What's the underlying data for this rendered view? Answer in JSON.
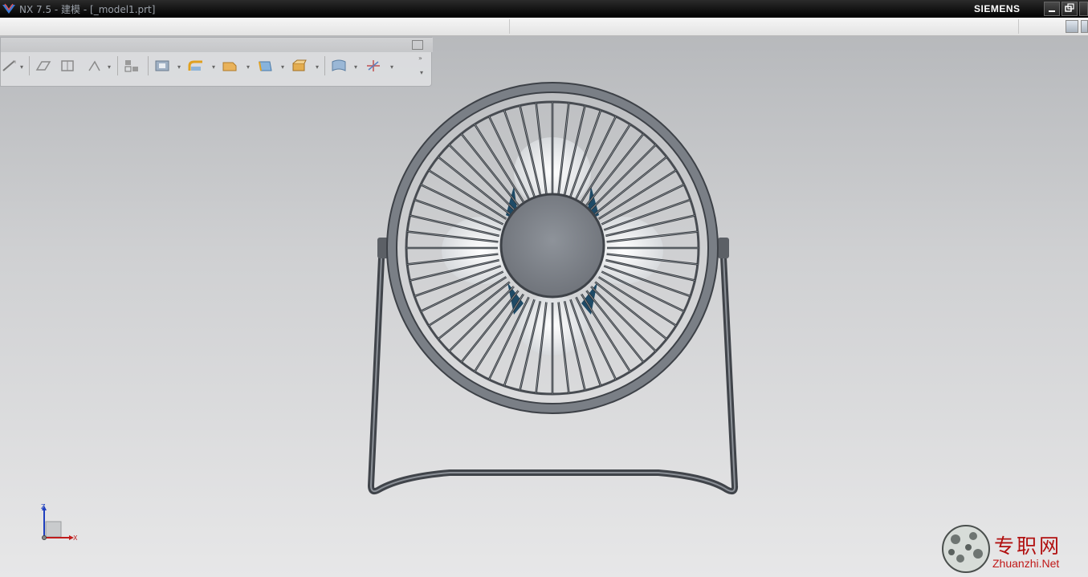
{
  "window": {
    "title": "NX 7.5 - 建模 - [_model1.prt]",
    "brand": "SIEMENS"
  },
  "triad": {
    "z_label": "Z",
    "x_label": "X"
  },
  "watermark": {
    "chinese": "专职网",
    "url": "Zhuanzhi.Net"
  },
  "colors": {
    "viewport_top": "#b7b9bc",
    "viewport_bottom": "#e7e7e8",
    "fan_body": "#7d8289",
    "fan_blade_accent": "#1e4a66"
  }
}
